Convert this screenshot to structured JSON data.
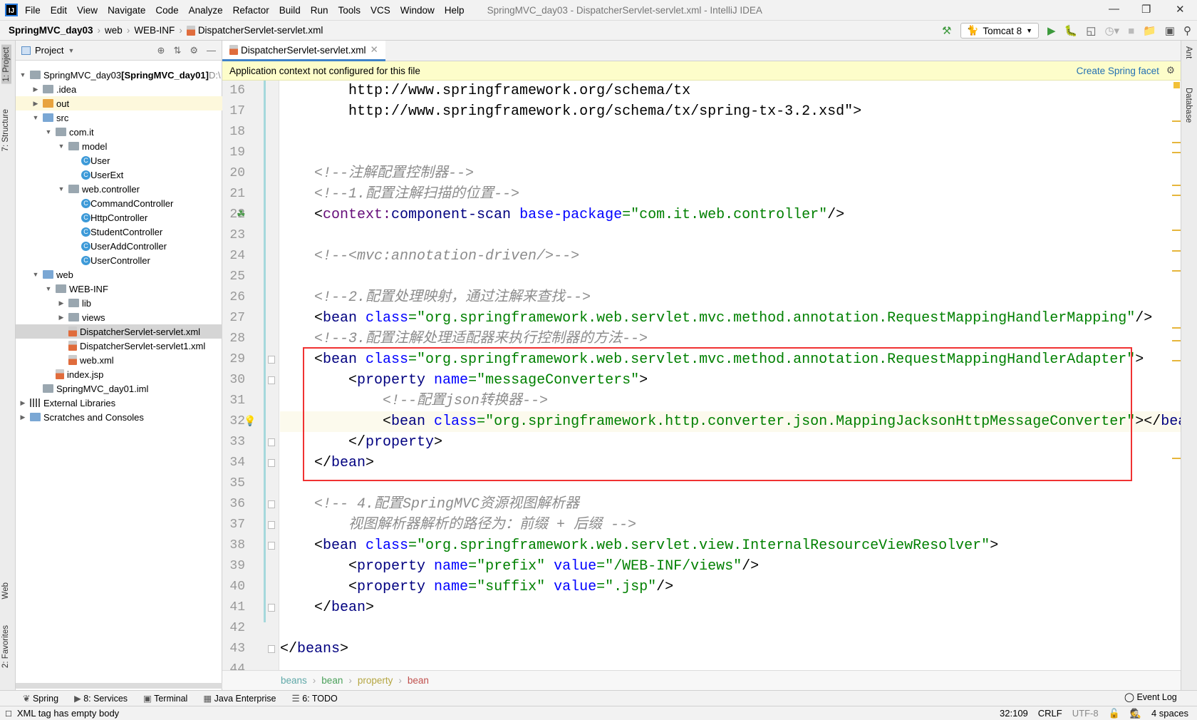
{
  "menubar": {
    "items": [
      "File",
      "Edit",
      "View",
      "Navigate",
      "Code",
      "Analyze",
      "Refactor",
      "Build",
      "Run",
      "Tools",
      "VCS",
      "Window",
      "Help"
    ],
    "title": "SpringMVC_day03 - DispatcherServlet-servlet.xml - IntelliJ IDEA"
  },
  "navbar": {
    "crumbs": [
      "SpringMVC_day03",
      "web",
      "WEB-INF",
      "DispatcherServlet-servlet.xml"
    ],
    "run_config": "Tomcat 8"
  },
  "left_stripe": {
    "project": "1: Project",
    "structure": "7: Structure",
    "web": "Web",
    "favorites": "2: Favorites"
  },
  "right_stripe": {
    "ant": "Ant",
    "database": "Database"
  },
  "project": {
    "header": "Project",
    "tree": [
      {
        "label": "SpringMVC_day03",
        "extra": " [SpringMVC_day01]",
        "suffix": " D:\\",
        "level": 0,
        "arrow": "open",
        "icon": "module"
      },
      {
        "label": ".idea",
        "level": 1,
        "arrow": "closed",
        "icon": "folder"
      },
      {
        "label": "out",
        "level": 1,
        "arrow": "closed",
        "icon": "folder-orange",
        "hl": true
      },
      {
        "label": "src",
        "level": 1,
        "arrow": "open",
        "icon": "folder-blue"
      },
      {
        "label": "com.it",
        "level": 2,
        "arrow": "open",
        "icon": "folder"
      },
      {
        "label": "model",
        "level": 3,
        "arrow": "open",
        "icon": "folder"
      },
      {
        "label": "User",
        "level": 4,
        "icon": "class"
      },
      {
        "label": "UserExt",
        "level": 4,
        "icon": "class"
      },
      {
        "label": "web.controller",
        "level": 3,
        "arrow": "open",
        "icon": "folder"
      },
      {
        "label": "CommandController",
        "level": 4,
        "icon": "class"
      },
      {
        "label": "HttpController",
        "level": 4,
        "icon": "class"
      },
      {
        "label": "StudentController",
        "level": 4,
        "icon": "class"
      },
      {
        "label": "UserAddController",
        "level": 4,
        "icon": "class"
      },
      {
        "label": "UserController",
        "level": 4,
        "icon": "class"
      },
      {
        "label": "web",
        "level": 1,
        "arrow": "open",
        "icon": "folder-blue"
      },
      {
        "label": "WEB-INF",
        "level": 2,
        "arrow": "open",
        "icon": "folder"
      },
      {
        "label": "lib",
        "level": 3,
        "arrow": "closed",
        "icon": "folder"
      },
      {
        "label": "views",
        "level": 3,
        "arrow": "closed",
        "icon": "folder"
      },
      {
        "label": "DispatcherServlet-servlet.xml",
        "level": 3,
        "icon": "xml",
        "selected": true
      },
      {
        "label": "DispatcherServlet-servlet1.xml",
        "level": 3,
        "icon": "xml"
      },
      {
        "label": "web.xml",
        "level": 3,
        "icon": "xml"
      },
      {
        "label": "index.jsp",
        "level": 2,
        "icon": "xml"
      },
      {
        "label": "SpringMVC_day01.iml",
        "level": 1,
        "icon": "module"
      },
      {
        "label": "External Libraries",
        "level": 0,
        "arrow": "closed",
        "icon": "lib"
      },
      {
        "label": "Scratches and Consoles",
        "level": 0,
        "arrow": "closed",
        "icon": "folder-blue"
      }
    ]
  },
  "editor": {
    "tab": "DispatcherServlet-servlet.xml",
    "banner": "Application context not configured for this file",
    "banner_link": "Create Spring facet",
    "current_line": 32,
    "lines": [
      {
        "n": 16,
        "t": [
          [
            "p",
            "        http://www.springframework.org/schema/tx"
          ]
        ]
      },
      {
        "n": 17,
        "t": [
          [
            "p",
            "        http://www.springframework.org/schema/tx/spring-tx-3.2.xsd\">"
          ]
        ]
      },
      {
        "n": 18,
        "t": []
      },
      {
        "n": 19,
        "t": []
      },
      {
        "n": 20,
        "t": [
          [
            "c",
            "    <!--注解配置控制器-->"
          ]
        ]
      },
      {
        "n": 21,
        "t": [
          [
            "c",
            "    <!--1.配置注解扫描的位置-->"
          ]
        ]
      },
      {
        "n": 22,
        "t": [
          [
            "t",
            "    <"
          ],
          [
            "ns",
            "context:"
          ],
          [
            "n",
            "component-scan"
          ],
          [
            "a",
            " base-package"
          ],
          [
            "v",
            "=\"com.it.web.controller\""
          ],
          [
            "t",
            "/>"
          ]
        ]
      },
      {
        "n": 23,
        "t": []
      },
      {
        "n": 24,
        "t": [
          [
            "c",
            "    <!--<mvc:annotation-driven/>-->"
          ]
        ]
      },
      {
        "n": 25,
        "t": []
      },
      {
        "n": 26,
        "t": [
          [
            "c",
            "    <!--2.配置处理映射，通过注解来查找-->"
          ]
        ]
      },
      {
        "n": 27,
        "t": [
          [
            "t",
            "    <"
          ],
          [
            "n",
            "bean"
          ],
          [
            "a",
            " class"
          ],
          [
            "v",
            "=\"org.springframework.web.servlet.mvc.method.annotation.RequestMappingHandlerMapping\""
          ],
          [
            "t",
            "/>"
          ]
        ]
      },
      {
        "n": 28,
        "t": [
          [
            "c",
            "    <!--3.配置注解处理适配器来执行控制器的方法-->"
          ]
        ]
      },
      {
        "n": 29,
        "t": [
          [
            "t",
            "    <"
          ],
          [
            "n",
            "bean"
          ],
          [
            "a",
            " class"
          ],
          [
            "v",
            "=\"org.springframework.web.servlet.mvc.method.annotation.RequestMappingHandlerAdapter\""
          ],
          [
            "t",
            ">"
          ]
        ]
      },
      {
        "n": 30,
        "t": [
          [
            "t",
            "        <"
          ],
          [
            "n",
            "property"
          ],
          [
            "a",
            " name"
          ],
          [
            "v",
            "=\"messageConverters\""
          ],
          [
            "t",
            ">"
          ]
        ]
      },
      {
        "n": 31,
        "t": [
          [
            "c",
            "            <!--配置json转换器-->"
          ]
        ]
      },
      {
        "n": 32,
        "t": [
          [
            "t",
            "            <"
          ],
          [
            "n",
            "bean"
          ],
          [
            "a",
            " class"
          ],
          [
            "v",
            "=\"org.springframework.http.converter.json.MappingJacksonHttpMessageConverter\""
          ],
          [
            "t",
            "></"
          ],
          [
            "n",
            "bean"
          ],
          [
            "t",
            ">"
          ]
        ]
      },
      {
        "n": 33,
        "t": [
          [
            "t",
            "        </"
          ],
          [
            "n",
            "property"
          ],
          [
            "t",
            ">"
          ]
        ]
      },
      {
        "n": 34,
        "t": [
          [
            "t",
            "    </"
          ],
          [
            "n",
            "bean"
          ],
          [
            "t",
            ">"
          ]
        ]
      },
      {
        "n": 35,
        "t": []
      },
      {
        "n": 36,
        "t": [
          [
            "c",
            "    <!-- 4.配置SpringMVC资源视图解析器"
          ]
        ]
      },
      {
        "n": 37,
        "t": [
          [
            "c",
            "        视图解析器解析的路径为：前缀 + 后缀 -->"
          ]
        ]
      },
      {
        "n": 38,
        "t": [
          [
            "t",
            "    <"
          ],
          [
            "n",
            "bean"
          ],
          [
            "a",
            " class"
          ],
          [
            "v",
            "=\"org.springframework.web.servlet.view.InternalResourceViewResolver\""
          ],
          [
            "t",
            ">"
          ]
        ]
      },
      {
        "n": 39,
        "t": [
          [
            "t",
            "        <"
          ],
          [
            "n",
            "property"
          ],
          [
            "a",
            " name"
          ],
          [
            "v",
            "=\"prefix\""
          ],
          [
            "a",
            " value"
          ],
          [
            "v",
            "=\"/WEB-INF/views\""
          ],
          [
            "t",
            "/>"
          ]
        ]
      },
      {
        "n": 40,
        "t": [
          [
            "t",
            "        <"
          ],
          [
            "n",
            "property"
          ],
          [
            "a",
            " name"
          ],
          [
            "v",
            "=\"suffix\""
          ],
          [
            "a",
            " value"
          ],
          [
            "v",
            "=\".jsp\""
          ],
          [
            "t",
            "/>"
          ]
        ]
      },
      {
        "n": 41,
        "t": [
          [
            "t",
            "    </"
          ],
          [
            "n",
            "bean"
          ],
          [
            "t",
            ">"
          ]
        ]
      },
      {
        "n": 42,
        "t": []
      },
      {
        "n": 43,
        "t": [
          [
            "t",
            "</"
          ],
          [
            "n",
            "beans"
          ],
          [
            "t",
            ">"
          ]
        ]
      },
      {
        "n": 44,
        "t": []
      }
    ],
    "breadcrumbs": [
      {
        "label": "beans",
        "color": "#5fa8a8"
      },
      {
        "label": "bean",
        "color": "#4aa05a"
      },
      {
        "label": "property",
        "color": "#b5a642"
      },
      {
        "label": "bean",
        "color": "#c0504d"
      }
    ]
  },
  "bottom_tools": [
    "Spring",
    "8: Services",
    "Terminal",
    "Java Enterprise",
    "6: TODO"
  ],
  "status": {
    "message": "XML tag has empty body",
    "event_log": "Event Log",
    "position": "32:109",
    "line_sep": "CRLF",
    "encoding": "UTF-8",
    "indent": "4 spaces"
  },
  "colors": {
    "accent": "#4083c9",
    "highlight_box": "#f03232",
    "banner": "#fdfdca"
  }
}
